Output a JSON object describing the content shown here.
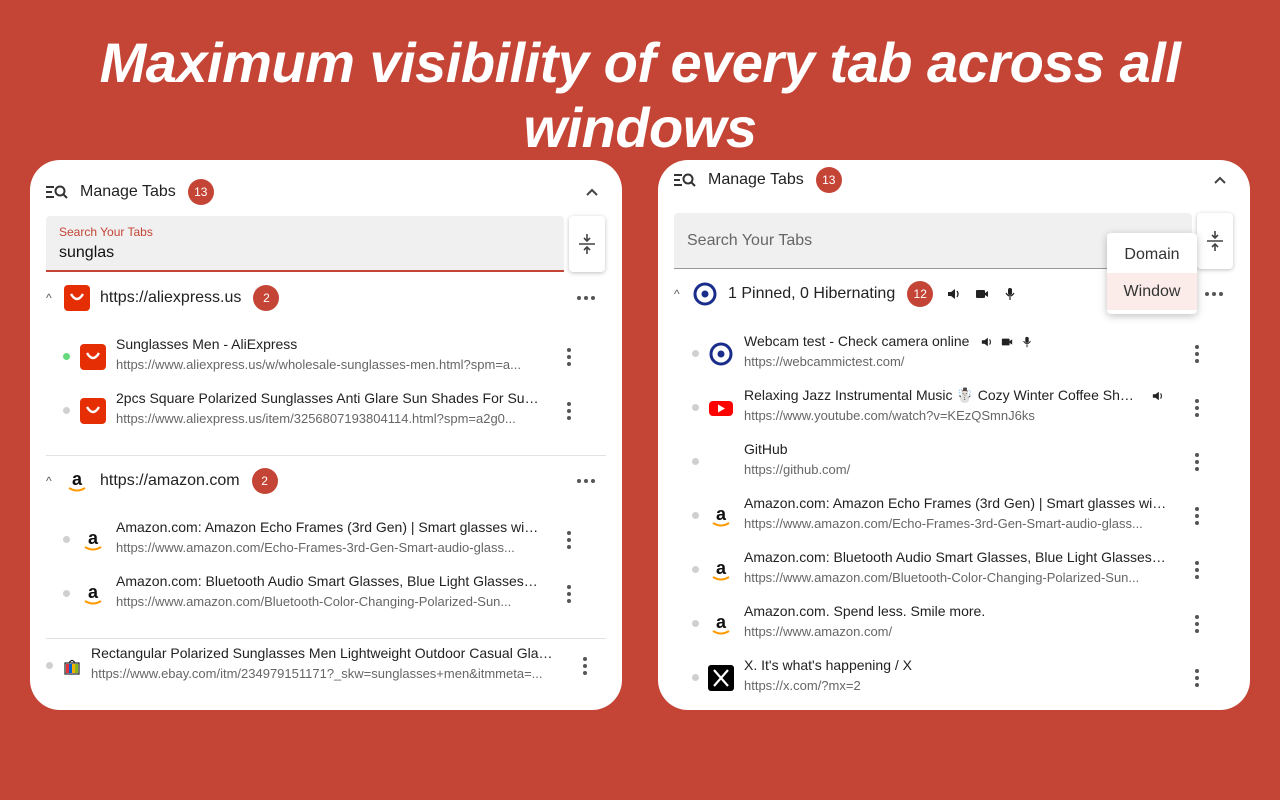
{
  "headline": "Maximum visibility of every tab across all windows",
  "colors": {
    "accent": "#c44536",
    "background": "#c44536",
    "active_dot": "#66d97a"
  },
  "left_panel": {
    "title": "Manage Tabs",
    "count": "13",
    "search": {
      "label": "Search Your Tabs",
      "value": "sunglas"
    },
    "groups": [
      {
        "title": "https://aliexpress.us",
        "count": "2",
        "favicon": "aliexpress-icon",
        "tabs": [
          {
            "title": "Sunglasses Men - AliExpress",
            "url": "https://www.aliexpress.us/w/wholesale-sunglasses-men.html?spm=a...",
            "active": true
          },
          {
            "title": "2pcs Square Polarized Sunglasses Anti Glare Sun Shades For Summe...",
            "url": "https://www.aliexpress.us/item/3256807193804114.html?spm=a2g0...",
            "active": false
          }
        ]
      },
      {
        "title": "https://amazon.com",
        "count": "2",
        "favicon": "amazon-icon",
        "tabs": [
          {
            "title": "Amazon.com: Amazon Echo Frames (3rd Gen) | Smart glasses with Al...",
            "url": "https://www.amazon.com/Echo-Frames-3rd-Gen-Smart-audio-glass...",
            "active": false
          },
          {
            "title": "Amazon.com: Bluetooth Audio Smart Glasses, Blue Light Glasses for ...",
            "url": "https://www.amazon.com/Bluetooth-Color-Changing-Polarized-Sun...",
            "active": false
          }
        ]
      }
    ],
    "loose_tab": {
      "title": "Rectangular Polarized Sunglasses Men Lightweight Outdoor Casual Glasses ...",
      "url": "https://www.ebay.com/itm/234979151171?_skw=sunglasses+men&itmmeta=...",
      "favicon": "ebay-icon"
    }
  },
  "right_panel": {
    "title": "Manage Tabs",
    "count": "13",
    "search": {
      "placeholder": "Search Your Tabs"
    },
    "group": {
      "title": "1 Pinned, 0 Hibernating",
      "count": "12"
    },
    "dropdown": {
      "options": [
        "Domain",
        "Window"
      ],
      "selected": "Window"
    },
    "tabs": [
      {
        "title": "Webcam test - Check camera online",
        "url": "https://webcammictest.com/",
        "favicon": "webcam-icon",
        "media": [
          "speaker",
          "camera",
          "mic"
        ]
      },
      {
        "title": "Relaxing Jazz Instrumental Music ☃️ Cozy Winter Coffee Shop A...",
        "url": "https://www.youtube.com/watch?v=KEzQSmnJ6ks",
        "favicon": "youtube-icon",
        "media": [
          "speaker"
        ]
      },
      {
        "title": "GitHub",
        "url": "https://github.com/",
        "favicon": "none",
        "media": []
      },
      {
        "title": "Amazon.com: Amazon Echo Frames (3rd Gen) | Smart glasses with Al...",
        "url": "https://www.amazon.com/Echo-Frames-3rd-Gen-Smart-audio-glass...",
        "favicon": "amazon-icon",
        "media": []
      },
      {
        "title": "Amazon.com: Bluetooth Audio Smart Glasses, Blue Light Glasses for ...",
        "url": "https://www.amazon.com/Bluetooth-Color-Changing-Polarized-Sun...",
        "favicon": "amazon-icon",
        "media": []
      },
      {
        "title": "Amazon.com. Spend less. Smile more.",
        "url": "https://www.amazon.com/",
        "favicon": "amazon-icon",
        "media": []
      },
      {
        "title": "X. It's what's happening / X",
        "url": "https://x.com/?mx=2",
        "favicon": "x-icon",
        "media": []
      }
    ]
  }
}
